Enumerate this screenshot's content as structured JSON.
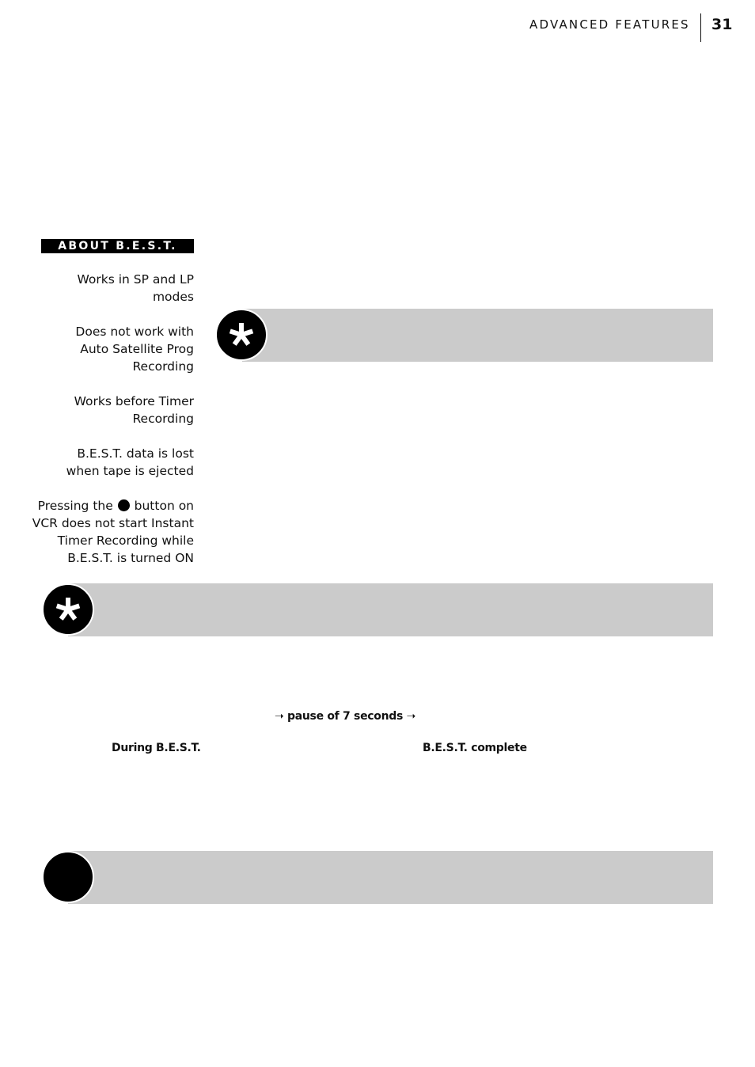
{
  "header": {
    "section_title": "ADVANCED FEATURES",
    "page_number": "31"
  },
  "sidebar": {
    "section_label": "ABOUT B.E.S.T.",
    "notes": [
      {
        "lines": [
          "Works in SP and LP",
          "modes"
        ]
      },
      {
        "lines": [
          "Does not work with",
          "Auto Satellite Prog",
          "Recording"
        ]
      },
      {
        "lines": [
          "Works before Timer",
          "Recording"
        ]
      },
      {
        "lines": [
          "B.E.S.T. data is lost",
          "when tape is ejected"
        ]
      },
      {
        "line1_before_icon": "Pressing the",
        "line1_icon": "record-dot-icon",
        "line1_after_icon": "button on",
        "lines_rest": [
          "VCR does not start Instant",
          "Timer Recording while",
          "B.E.S.T. is turned ON"
        ]
      }
    ]
  },
  "callouts": [
    {
      "icon": "asterisk-icon",
      "text": ""
    },
    {
      "icon": "asterisk-icon",
      "text": ""
    },
    {
      "icon": "filled-circle-icon",
      "text": ""
    }
  ],
  "display_sequence": {
    "transition_arrow_left": "➝",
    "transition_label": "pause of 7 seconds",
    "transition_arrow_right": "➝",
    "during_label": "During B.E.S.T.",
    "complete_label": "B.E.S.T. complete"
  },
  "colors": {
    "callout_background": "#cbcbcb",
    "badge_background": "#000000",
    "label_background": "#000000",
    "text": "#111111"
  }
}
